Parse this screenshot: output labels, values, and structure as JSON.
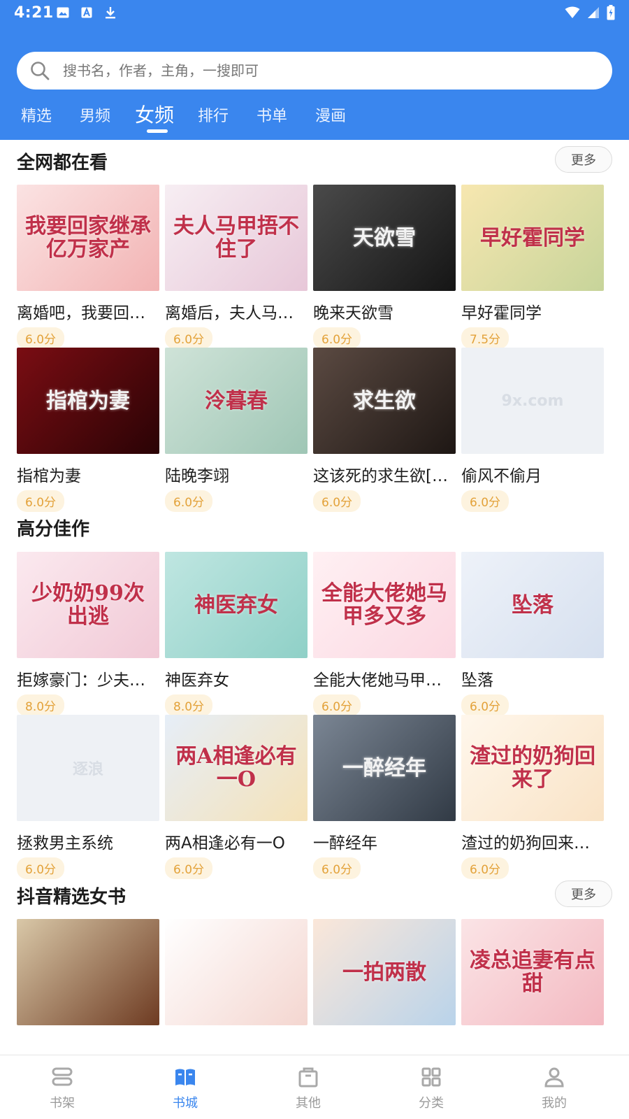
{
  "status": {
    "time": "4:21"
  },
  "search": {
    "placeholder": "搜书名，作者，主角，一搜即可"
  },
  "tabs": [
    "精选",
    "男频",
    "女频",
    "排行",
    "书单",
    "漫画"
  ],
  "active_tab": "女频",
  "sections": [
    {
      "title": "全网都在看",
      "more_label": "更多",
      "books": [
        {
          "title": "离婚吧，我要回…",
          "score": "6.0分",
          "cover_text": "我要回家继承亿万家产",
          "cover_colors": [
            "#fbe3e3",
            "#f2b3b3"
          ]
        },
        {
          "title": "离婚后，夫人马…",
          "score": "6.0分",
          "cover_text": "夫人马甲捂不住了",
          "cover_colors": [
            "#f7eef3",
            "#e7c7d8"
          ]
        },
        {
          "title": "晚来天欲雪",
          "score": "6.0分",
          "cover_text": "天欲雪",
          "cover_colors": [
            "#4a4a4a",
            "#151515"
          ]
        },
        {
          "title": "早好霍同学",
          "score": "7.5分",
          "cover_text": "早好霍同学",
          "cover_colors": [
            "#f7e7b0",
            "#c7d49a"
          ]
        },
        {
          "title": "指棺为妻",
          "score": "6.0分",
          "cover_text": "指棺为妻",
          "cover_colors": [
            "#7a0d13",
            "#2a0305"
          ]
        },
        {
          "title": "陆晚李翊",
          "score": "6.0分",
          "cover_text": "泠暮春",
          "cover_colors": [
            "#cfe3d8",
            "#9fc6b5"
          ]
        },
        {
          "title": "这该死的求生欲[…",
          "score": "6.0分",
          "cover_text": "求生欲",
          "cover_colors": [
            "#5b4a42",
            "#1e1714"
          ]
        },
        {
          "title": "偷风不偷月",
          "score": "6.0分",
          "cover_text": "9x.com",
          "cover_colors": [
            "#eef1f5",
            "#eef1f5"
          ]
        }
      ]
    },
    {
      "title": "高分佳作",
      "books": [
        {
          "title": "拒嫁豪门：少夫…",
          "score": "8.0分",
          "cover_text": "少奶奶99次出逃",
          "cover_colors": [
            "#fbe9ef",
            "#f1c9d6"
          ]
        },
        {
          "title": "神医弃女",
          "score": "8.0分",
          "cover_text": "神医弃女",
          "cover_colors": [
            "#bfe6e1",
            "#8fd0c7"
          ]
        },
        {
          "title": "全能大佬她马甲…",
          "score": "6.0分",
          "cover_text": "全能大佬她马甲多又多",
          "cover_colors": [
            "#fff0f3",
            "#fbd8e2"
          ]
        },
        {
          "title": "坠落",
          "score": "6.0分",
          "cover_text": "坠落",
          "cover_colors": [
            "#eef2f9",
            "#d6e0ef"
          ]
        },
        {
          "title": "拯救男主系统",
          "score": "6.0分",
          "cover_text": "逐浪",
          "cover_colors": [
            "#eef2f6",
            "#dfe6ee"
          ]
        },
        {
          "title": "两A相逢必有一O",
          "score": "6.0分",
          "cover_text": "两A相逢必有一O",
          "cover_colors": [
            "#e6eef8",
            "#f5e2b8"
          ]
        },
        {
          "title": "一醉经年",
          "score": "6.0分",
          "cover_text": "一醉经年",
          "cover_colors": [
            "#7b8694",
            "#313a45"
          ]
        },
        {
          "title": "渣过的奶狗回来…",
          "score": "6.0分",
          "cover_text": "渣过的奶狗回来了",
          "cover_colors": [
            "#fff7ec",
            "#f9e3c6"
          ]
        }
      ]
    },
    {
      "title": "抖音精选女书",
      "more_label": "更多",
      "books": [
        {
          "title": "",
          "score": "",
          "cover_text": "",
          "cover_colors": [
            "#d9c8a8",
            "#6e3b22"
          ]
        },
        {
          "title": "",
          "score": "",
          "cover_text": "",
          "cover_colors": [
            "#ffffff",
            "#f4d6d0"
          ]
        },
        {
          "title": "",
          "score": "",
          "cover_text": "一拍两散",
          "cover_colors": [
            "#fbe7d9",
            "#b9d3ea"
          ]
        },
        {
          "title": "",
          "score": "",
          "cover_text": "凌总追妻有点甜",
          "cover_colors": [
            "#fbe4e6",
            "#f3b9c1"
          ]
        }
      ]
    }
  ],
  "bottom_nav": [
    {
      "label": "书架",
      "icon": "bookshelf-icon"
    },
    {
      "label": "书城",
      "icon": "bookstore-icon",
      "active": true
    },
    {
      "label": "其他",
      "icon": "bag-icon"
    },
    {
      "label": "分类",
      "icon": "grid-icon"
    },
    {
      "label": "我的",
      "icon": "profile-icon"
    }
  ],
  "colors": {
    "primary": "#3a86ee",
    "score_text": "#e3a23a",
    "score_bg": "#fdf3df"
  }
}
